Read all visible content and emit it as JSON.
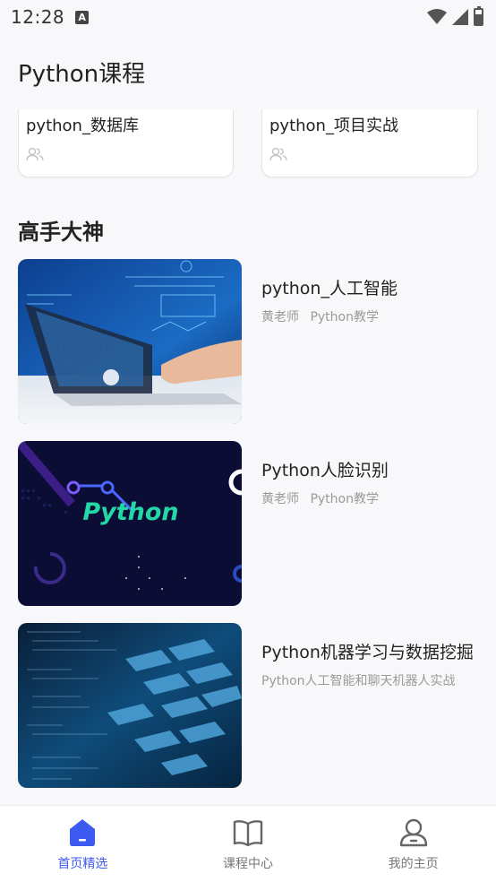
{
  "status_bar": {
    "time": "12:28",
    "notification_letter": "A"
  },
  "page": {
    "title": "Python课程"
  },
  "top_courses": [
    {
      "title": "python_数据库",
      "icon": "users-icon"
    },
    {
      "title": "python_项目实战",
      "icon": "users-icon"
    }
  ],
  "section": {
    "title": "高手大神"
  },
  "courses": [
    {
      "title": "python_人工智能",
      "teacher": "黄老师",
      "tag": "Python教学",
      "thumb": "laptop-ai-image"
    },
    {
      "title": "Python人脸识别",
      "teacher": "黄老师",
      "tag": "Python教学",
      "thumb": "python-logo-image",
      "thumb_text": "Python"
    },
    {
      "title": "Python机器学习与数据挖掘",
      "subtitle": "Python人工智能和聊天机器人实战",
      "thumb": "keyboard-code-image"
    }
  ],
  "bottom_nav": [
    {
      "label": "首页精选",
      "icon": "home-icon",
      "active": true
    },
    {
      "label": "课程中心",
      "icon": "book-icon",
      "active": false
    },
    {
      "label": "我的主页",
      "icon": "profile-icon",
      "active": false
    }
  ],
  "colors": {
    "accent": "#3d5af1",
    "background": "#f8f8fa",
    "muted_text": "#9a9a9a"
  }
}
